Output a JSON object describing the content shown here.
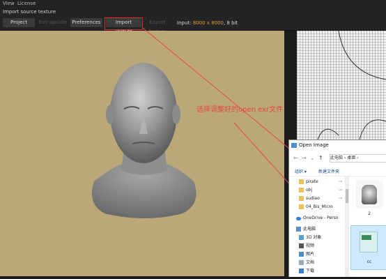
{
  "menu": {
    "items": [
      "View",
      "License"
    ]
  },
  "window_title": "Import source texture",
  "toolbar": {
    "project": "Project",
    "extrapolate": "Extrapolate",
    "preferences": "Preferences",
    "import_texture": "Import Texture",
    "export_texture": "Export Texture",
    "input_label": "Input:",
    "input_size": "8000 x 8000",
    "input_depth": ", 8 bit"
  },
  "annotation": {
    "text": "选择调整好的open exr文件",
    "color": "#e64646"
  },
  "dialog": {
    "title": "Open Image",
    "address": "此电脑 › 桌面 ›",
    "organize": "组织 ▾",
    "new_folder": "新建文件夹",
    "nav_items": [
      {
        "label": "pirate",
        "icon": "folder-icon",
        "pinned": true
      },
      {
        "label": "obj",
        "icon": "folder-icon",
        "pinned": true
      },
      {
        "label": "sudiao",
        "icon": "folder-icon",
        "pinned": true
      },
      {
        "label": "04_Bis_Micro",
        "icon": "folder-icon",
        "pinned": false
      },
      {
        "label": "OneDrive - Perso",
        "icon": "cloud-icon",
        "pinned": false
      },
      {
        "label": "此电脑",
        "icon": "computer-icon",
        "pinned": false
      },
      {
        "label": "3D 对象",
        "icon": "3d-objects-icon",
        "pinned": false
      },
      {
        "label": "视频",
        "icon": "video-icon",
        "pinned": false
      },
      {
        "label": "图片",
        "icon": "picture-icon",
        "pinned": false
      },
      {
        "label": "文档",
        "icon": "document-icon",
        "pinned": false
      },
      {
        "label": "下载",
        "icon": "download-icon",
        "pinned": false
      }
    ],
    "files": [
      {
        "name": "2",
        "kind": "image-thumbnail"
      },
      {
        "name": "cc",
        "kind": "exr-file",
        "selected": true
      }
    ]
  },
  "colors": {
    "viewport_bg": "#bba879",
    "highlight_box": "#e03030",
    "accent": "#e0a030"
  }
}
